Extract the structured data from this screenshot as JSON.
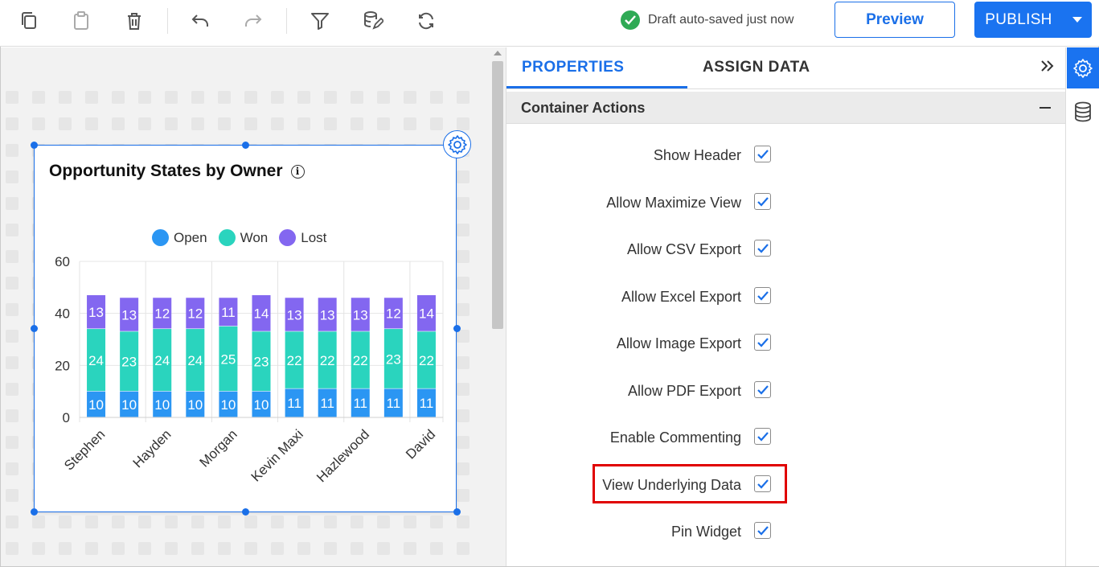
{
  "toolbar": {
    "icons": [
      "copy-icon",
      "paste-icon",
      "delete-icon",
      "undo-icon",
      "redo-icon",
      "filter-icon",
      "datasource-edit-icon",
      "refresh-icon"
    ],
    "status_text": "Draft auto-saved just now",
    "preview_label": "Preview",
    "publish_label": "PUBLISH"
  },
  "widget": {
    "title": "Opportunity States by Owner",
    "info_glyph": "i"
  },
  "chart_data": {
    "type": "bar",
    "stacked": true,
    "title": "Opportunity States by Owner",
    "categories": [
      "Stephen",
      "",
      "Hayden",
      "",
      "Morgan",
      "",
      "Kevin Maxi",
      "",
      "Hazlewood",
      "",
      "David"
    ],
    "series": [
      {
        "name": "Open",
        "color": "#2b96f3",
        "values": [
          10,
          10,
          10,
          10,
          10,
          10,
          11,
          11,
          11,
          11,
          11
        ]
      },
      {
        "name": "Won",
        "color": "#2ad4be",
        "values": [
          24,
          23,
          24,
          24,
          25,
          23,
          22,
          22,
          22,
          23,
          22
        ]
      },
      {
        "name": "Lost",
        "color": "#8367f0",
        "values": [
          13,
          13,
          12,
          12,
          11,
          14,
          13,
          13,
          13,
          12,
          14
        ]
      }
    ],
    "ylim": [
      0,
      60
    ],
    "yticks": [
      "0",
      "20",
      "40",
      "60"
    ],
    "grid": true,
    "legend_position": "top"
  },
  "panel": {
    "tabs": [
      {
        "label": "PROPERTIES",
        "active": true
      },
      {
        "label": "ASSIGN DATA",
        "active": false
      }
    ],
    "section_title": "Container Actions",
    "properties": [
      {
        "label": "Show Header",
        "checked": true
      },
      {
        "label": "Allow Maximize View",
        "checked": true
      },
      {
        "label": "Allow CSV Export",
        "checked": true
      },
      {
        "label": "Allow Excel Export",
        "checked": true
      },
      {
        "label": "Allow Image Export",
        "checked": true
      },
      {
        "label": "Allow PDF Export",
        "checked": true
      },
      {
        "label": "Enable Commenting",
        "checked": true
      },
      {
        "label": "View Underlying Data",
        "checked": true,
        "highlighted": true
      },
      {
        "label": "Pin Widget",
        "checked": true
      }
    ]
  },
  "colors": {
    "accent": "#1a73f0",
    "success": "#2faa55",
    "highlight": "#e00000"
  }
}
